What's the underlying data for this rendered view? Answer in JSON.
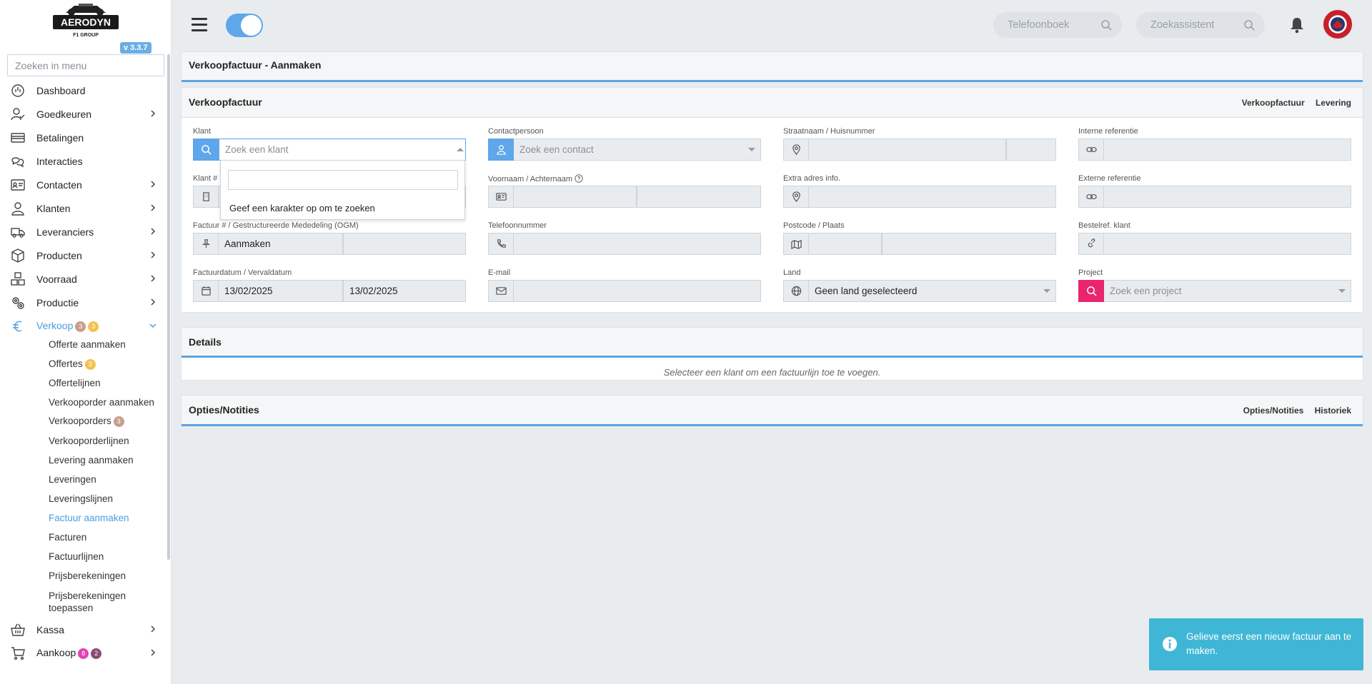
{
  "app": {
    "logo_text": "AERODYN",
    "logo_sub": "F1 GROUP",
    "version": "v 3.3.7"
  },
  "sidebar": {
    "search_placeholder": "Zoeken in menu",
    "items": [
      {
        "label": "Dashboard",
        "icon": "dashboard-icon"
      },
      {
        "label": "Goedkeuren",
        "icon": "user-check-icon"
      },
      {
        "label": "Betalingen",
        "icon": "credit-card-icon"
      },
      {
        "label": "Interacties",
        "icon": "chat-icon"
      },
      {
        "label": "Contacten",
        "icon": "contact-card-icon"
      },
      {
        "label": "Klanten",
        "icon": "user-icon"
      },
      {
        "label": "Leveranciers",
        "icon": "truck-icon"
      },
      {
        "label": "Producten",
        "icon": "box-icon"
      },
      {
        "label": "Voorraad",
        "icon": "boxes-icon"
      },
      {
        "label": "Productie",
        "icon": "gears-icon"
      },
      {
        "label": "Verkoop",
        "icon": "euro-icon",
        "badges": [
          "3",
          "3"
        ]
      },
      {
        "label": "Kassa",
        "icon": "basket-icon"
      },
      {
        "label": "Aankoop",
        "icon": "cart-icon",
        "badges": [
          "8",
          "2"
        ]
      }
    ],
    "verkoop_sub": [
      {
        "label": "Offerte aanmaken"
      },
      {
        "label": "Offertes",
        "badge": "3"
      },
      {
        "label": "Offertelijnen"
      },
      {
        "label": "Verkooporder aanmaken"
      },
      {
        "label": "Verkooporders",
        "badge": "3"
      },
      {
        "label": "Verkooporderlijnen"
      },
      {
        "label": "Levering aanmaken"
      },
      {
        "label": "Leveringen"
      },
      {
        "label": "Leveringslijnen"
      },
      {
        "label": "Factuur aanmaken"
      },
      {
        "label": "Facturen"
      },
      {
        "label": "Factuurlijnen"
      },
      {
        "label": "Prijsberekeningen"
      },
      {
        "label": "Prijsberekeningen toepassen"
      }
    ]
  },
  "topbar": {
    "phonebook_placeholder": "Telefoonboek",
    "assistant_placeholder": "Zoekassistent"
  },
  "page": {
    "title": "Verkoopfactuur - Aanmaken"
  },
  "invoice": {
    "title": "Verkoopfactuur",
    "links": [
      "Verkoopfactuur",
      "Levering"
    ],
    "klant_label": "Klant",
    "klant_placeholder": "Zoek een klant",
    "klantnr_label": "Klant #",
    "factuur_label": "Factuur # / Gestructureerde Mededeling (OGM)",
    "factuur_value": "Aanmaken",
    "datum_label": "Factuurdatum / Vervaldatum",
    "factuurdatum": "13/02/2025",
    "vervaldatum": "13/02/2025",
    "contact_label": "Contactpersoon",
    "contact_placeholder": "Zoek een contact",
    "naam_label": "Voornaam / Achternaam",
    "telefoon_label": "Telefoonnummer",
    "email_label": "E-mail",
    "straat_label": "Straatnaam / Huisnummer",
    "extra_label": "Extra adres info.",
    "postcode_label": "Postcode / Plaats",
    "land_label": "Land",
    "land_value": "Geen land geselecteerd",
    "intref_label": "Interne referentie",
    "extref_label": "Externe referentie",
    "bestelref_label": "Bestelref. klant",
    "project_label": "Project",
    "project_placeholder": "Zoek een project"
  },
  "dropdown": {
    "message": "Geef een karakter op om te zoeken"
  },
  "details": {
    "title": "Details",
    "empty_message": "Selecteer een klant om een factuurlijn toe te voegen."
  },
  "options": {
    "title": "Opties/Notities",
    "links": [
      "Opties/Notities",
      "Historiek"
    ]
  },
  "toast": {
    "message": "Gelieve eerst een nieuw factuur aan te maken.",
    "color": "#3fb6d6"
  },
  "colors": {
    "accent": "#5fa6ea",
    "project_addon": "#e8256d"
  }
}
